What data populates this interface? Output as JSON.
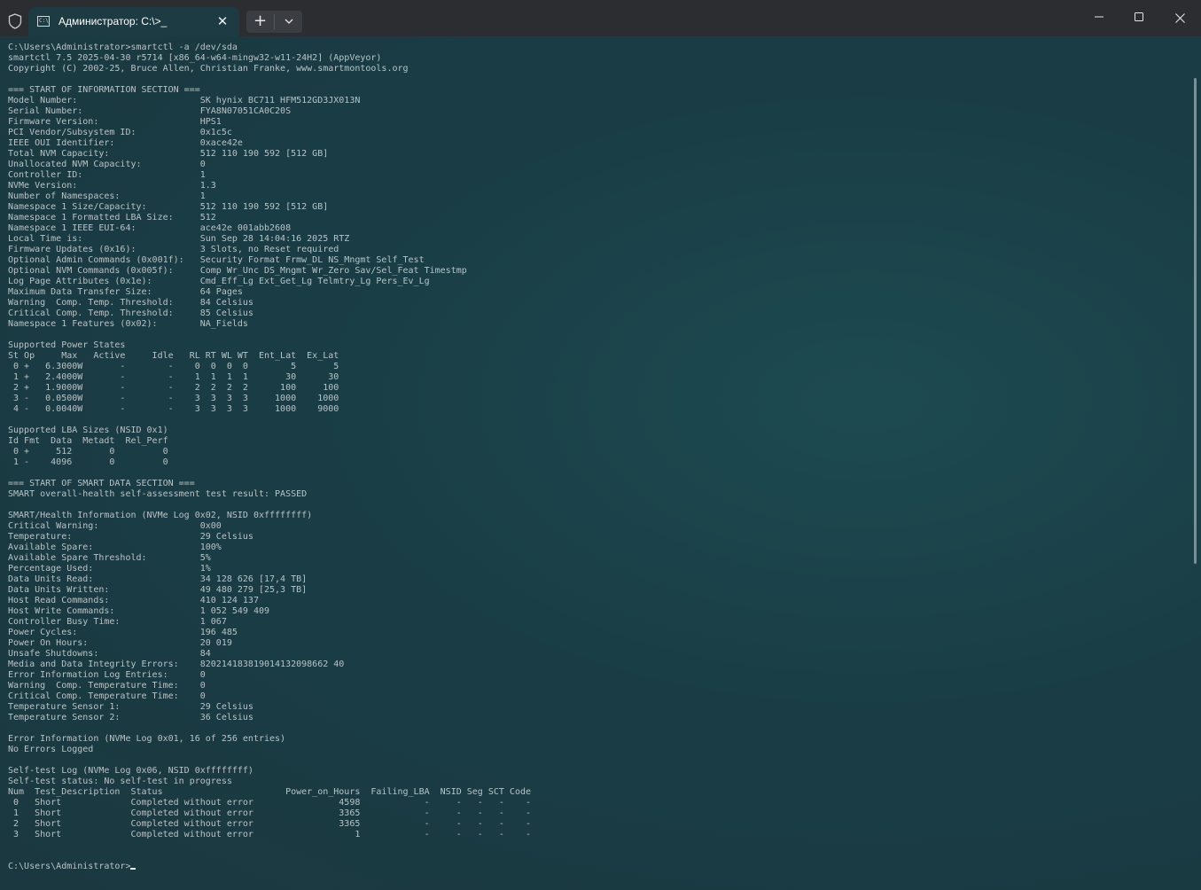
{
  "window": {
    "tab_title": "Администратор: C:\\>_",
    "tab_icon_glyph": "C:\\",
    "close_tab_glyph": "✕",
    "new_tab_glyph": "+",
    "dropdown_glyph": "⌄",
    "minimize_glyph": "─",
    "maximize_glyph": "☐",
    "close_glyph": "✕"
  },
  "terminal": {
    "lines": [
      "C:\\Users\\Administrator>smartctl -a /dev/sda",
      "smartctl 7.5 2025-04-30 r5714 [x86_64-w64-mingw32-w11-24H2] (AppVeyor)",
      "Copyright (C) 2002-25, Bruce Allen, Christian Franke, www.smartmontools.org",
      "",
      "=== START OF INFORMATION SECTION ===",
      "Model Number:                       SK hynix BC711 HFM512GD3JX013N",
      "Serial Number:                      FYA8N07051CA0C20S",
      "Firmware Version:                   HPS1",
      "PCI Vendor/Subsystem ID:            0x1c5c",
      "IEEE OUI Identifier:                0xace42e",
      "Total NVM Capacity:                 512 110 190 592 [512 GB]",
      "Unallocated NVM Capacity:           0",
      "Controller ID:                      1",
      "NVMe Version:                       1.3",
      "Number of Namespaces:               1",
      "Namespace 1 Size/Capacity:          512 110 190 592 [512 GB]",
      "Namespace 1 Formatted LBA Size:     512",
      "Namespace 1 IEEE EUI-64:            ace42e 001abb2608",
      "Local Time is:                      Sun Sep 28 14:04:16 2025 RTZ",
      "Firmware Updates (0x16):            3 Slots, no Reset required",
      "Optional Admin Commands (0x001f):   Security Format Frmw_DL NS_Mngmt Self_Test",
      "Optional NVM Commands (0x005f):     Comp Wr_Unc DS_Mngmt Wr_Zero Sav/Sel_Feat Timestmp",
      "Log Page Attributes (0x1e):         Cmd_Eff_Lg Ext_Get_Lg Telmtry_Lg Pers_Ev_Lg",
      "Maximum Data Transfer Size:         64 Pages",
      "Warning  Comp. Temp. Threshold:     84 Celsius",
      "Critical Comp. Temp. Threshold:     85 Celsius",
      "Namespace 1 Features (0x02):        NA_Fields",
      "",
      "Supported Power States",
      "St Op     Max   Active     Idle   RL RT WL WT  Ent_Lat  Ex_Lat",
      " 0 +   6.3000W       -        -    0  0  0  0        5       5",
      " 1 +   2.4000W       -        -    1  1  1  1       30      30",
      " 2 +   1.9000W       -        -    2  2  2  2      100     100",
      " 3 -   0.0500W       -        -    3  3  3  3     1000    1000",
      " 4 -   0.0040W       -        -    3  3  3  3     1000    9000",
      "",
      "Supported LBA Sizes (NSID 0x1)",
      "Id Fmt  Data  Metadt  Rel_Perf",
      " 0 +     512       0         0",
      " 1 -    4096       0         0",
      "",
      "=== START OF SMART DATA SECTION ===",
      "SMART overall-health self-assessment test result: PASSED",
      "",
      "SMART/Health Information (NVMe Log 0x02, NSID 0xffffffff)",
      "Critical Warning:                   0x00",
      "Temperature:                        29 Celsius",
      "Available Spare:                    100%",
      "Available Spare Threshold:          5%",
      "Percentage Used:                    1%",
      "Data Units Read:                    34 128 626 [17,4 TB]",
      "Data Units Written:                 49 480 279 [25,3 TB]",
      "Host Read Commands:                 410 124 137",
      "Host Write Commands:                1 052 549 409",
      "Controller Busy Time:               1 067",
      "Power Cycles:                       196 485",
      "Power On Hours:                     20 019",
      "Unsafe Shutdowns:                   84",
      "Media and Data Integrity Errors:    820214183819014132098662 40",
      "Error Information Log Entries:      0",
      "Warning  Comp. Temperature Time:    0",
      "Critical Comp. Temperature Time:    0",
      "Temperature Sensor 1:               29 Celsius",
      "Temperature Sensor 2:               36 Celsius",
      "",
      "Error Information (NVMe Log 0x01, 16 of 256 entries)",
      "No Errors Logged",
      "",
      "Self-test Log (NVMe Log 0x06, NSID 0xffffffff)",
      "Self-test status: No self-test in progress",
      "Num  Test_Description  Status                       Power_on_Hours  Failing_LBA  NSID Seg SCT Code",
      " 0   Short             Completed without error                4598            -     -   -   -    -",
      " 1   Short             Completed without error                3365            -     -   -   -    -",
      " 2   Short             Completed without error                3365            -     -   -   -    -",
      " 3   Short             Completed without error                   1            -     -   -   -    -",
      "",
      ""
    ],
    "prompt": "C:\\Users\\Administrator>"
  }
}
